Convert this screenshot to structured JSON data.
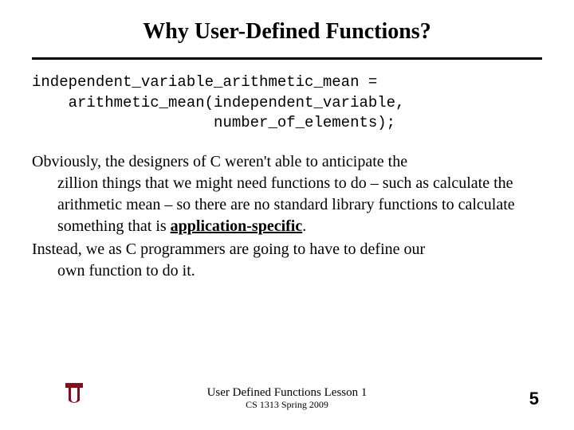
{
  "title": "Why User-Defined Functions?",
  "code": {
    "l1": "independent_variable_arithmetic_mean =",
    "l2": "    arithmetic_mean(independent_variable,",
    "l3": "                    number_of_elements);"
  },
  "body": {
    "p1_lead": "Obviously, the designers of C weren't able to anticipate the",
    "p1_rest": "zillion things that we might need functions to do – such as calculate the arithmetic mean – so there are no standard library functions to calculate something that is ",
    "app_spec": "application-specific",
    "period": ".",
    "p2_lead": "Instead, we as C programmers are going to have to define our",
    "p2_rest": "own function to do it."
  },
  "footer": {
    "line1": "User Defined Functions Lesson 1",
    "line2": "CS 1313 Spring 2009",
    "page": "5"
  }
}
